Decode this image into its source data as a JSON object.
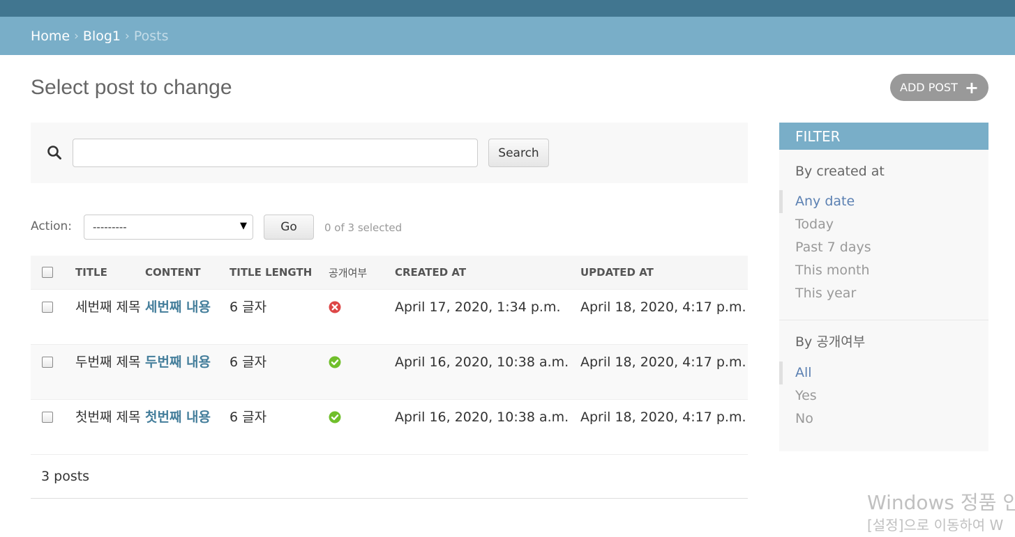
{
  "breadcrumbs": {
    "home": "Home",
    "sep": "›",
    "app": "Blog1",
    "current": "Posts"
  },
  "page": {
    "title": "Select post to change",
    "add_button": "ADD POST",
    "add_icon": "+"
  },
  "search": {
    "value": "",
    "button_label": "Search"
  },
  "actions": {
    "label": "Action:",
    "selected_option": "---------",
    "go_label": "Go",
    "selected_count": "0 of 3 selected"
  },
  "table": {
    "columns": {
      "title": "TITLE",
      "content": "CONTENT",
      "title_length": "TITLE LENGTH",
      "is_public": "공개여부",
      "created_at": "CREATED AT",
      "updated_at": "UPDATED AT"
    },
    "rows": [
      {
        "title": "세번째 제목",
        "content": "세번째 내용",
        "title_length": "6 글자",
        "is_public": false,
        "created_at": "April 17, 2020, 1:34 p.m.",
        "updated_at": "April 18, 2020, 4:17 p.m."
      },
      {
        "title": "두번째 제목",
        "content": "두번째 내용",
        "title_length": "6 글자",
        "is_public": true,
        "created_at": "April 16, 2020, 10:38 a.m.",
        "updated_at": "April 18, 2020, 4:17 p.m."
      },
      {
        "title": "첫번째 제목",
        "content": "첫번째 내용",
        "title_length": "6 글자",
        "is_public": true,
        "created_at": "April 16, 2020, 10:38 a.m.",
        "updated_at": "April 18, 2020, 4:17 p.m."
      }
    ]
  },
  "paginator": {
    "count_text": "3 posts"
  },
  "filter": {
    "heading": "FILTER",
    "groups": [
      {
        "title": "By created at",
        "options": [
          "Any date",
          "Today",
          "Past 7 days",
          "This month",
          "This year"
        ],
        "selected": 0
      },
      {
        "title": "By 공개여부",
        "options": [
          "All",
          "Yes",
          "No"
        ],
        "selected": 0
      }
    ]
  },
  "watermark": {
    "line1": "Windows 정품 인",
    "line2": "[설정]으로 이동하여 W"
  },
  "colors": {
    "header_dark": "#417690",
    "header_light": "#79aec8",
    "link": "#447e9b",
    "status_yes": "#70bf2b",
    "status_no": "#dd4646"
  }
}
